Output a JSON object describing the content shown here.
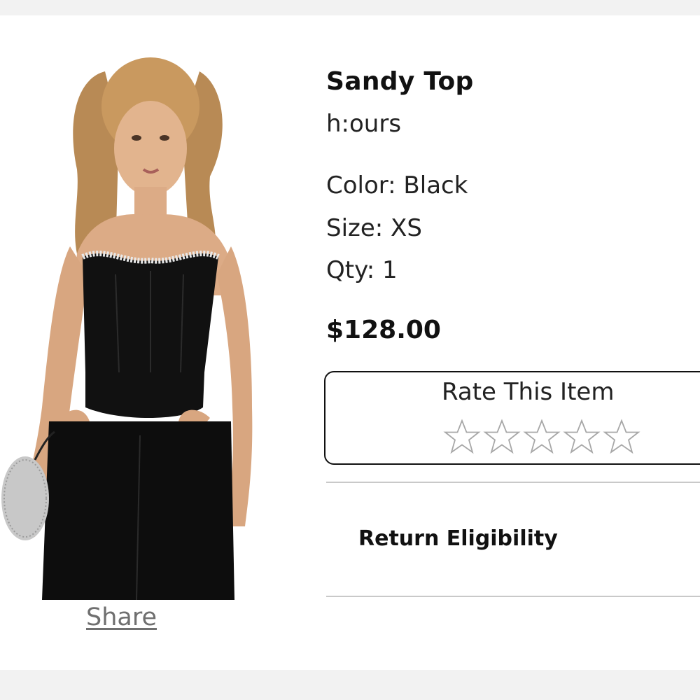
{
  "product": {
    "name": "Sandy Top",
    "brand": "h:ours",
    "color_line": "Color: Black",
    "size_line": "Size: XS",
    "qty_line": "Qty: 1",
    "price": "$128.00",
    "image_icon": "product-photo-model-black-strapless-corset-top"
  },
  "share": {
    "label": "Share"
  },
  "rating": {
    "label": "Rate This Item",
    "stars_filled": 0,
    "stars_total": 5,
    "star_icon": "star-outline-icon"
  },
  "return_eligibility": {
    "label": "Return Eligibility"
  },
  "colors": {
    "page_bg": "#f2f2f2",
    "card_bg": "#ffffff",
    "text": "#111111",
    "link": "#6f6f6f",
    "divider": "#c9c9c9"
  }
}
